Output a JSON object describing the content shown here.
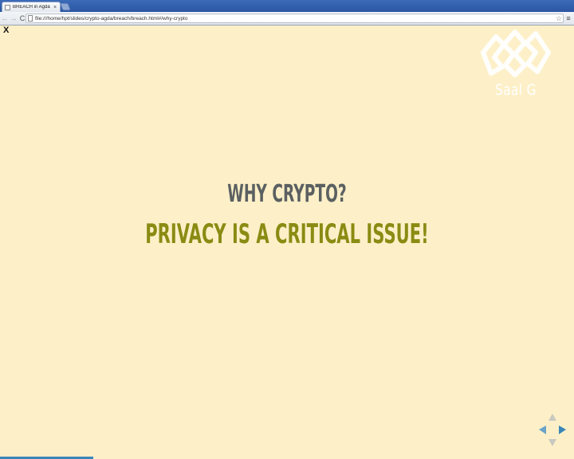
{
  "browser": {
    "tab_title": "BREACH in Agda",
    "tab_close": "×",
    "url": "file:///home/hpt/slides/crypto-agda/breach/breach.html#/why-crypto",
    "back_glyph": "←",
    "forward_glyph": "→",
    "reload_glyph": "C",
    "star_glyph": "☆",
    "menu_glyph": "≡"
  },
  "slide": {
    "close_label": "X",
    "logo_text": "Saal G",
    "heading": "WHY CRYPTO?",
    "subheading": "PRIVACY IS A CRITICAL ISSUE!",
    "progress_fraction": 0.163
  },
  "colors": {
    "background": "#fdf0c8",
    "heading": "#5b6061",
    "subheading": "#8a8b13",
    "accent": "#3a86b8"
  },
  "icons": [
    "tab-favicon-icon",
    "back-arrow-icon",
    "forward-arrow-icon",
    "reload-icon",
    "page-icon",
    "star-icon",
    "menu-icon",
    "close-icon",
    "logo-icon",
    "nav-up-icon",
    "nav-down-icon",
    "nav-left-icon",
    "nav-right-icon"
  ]
}
